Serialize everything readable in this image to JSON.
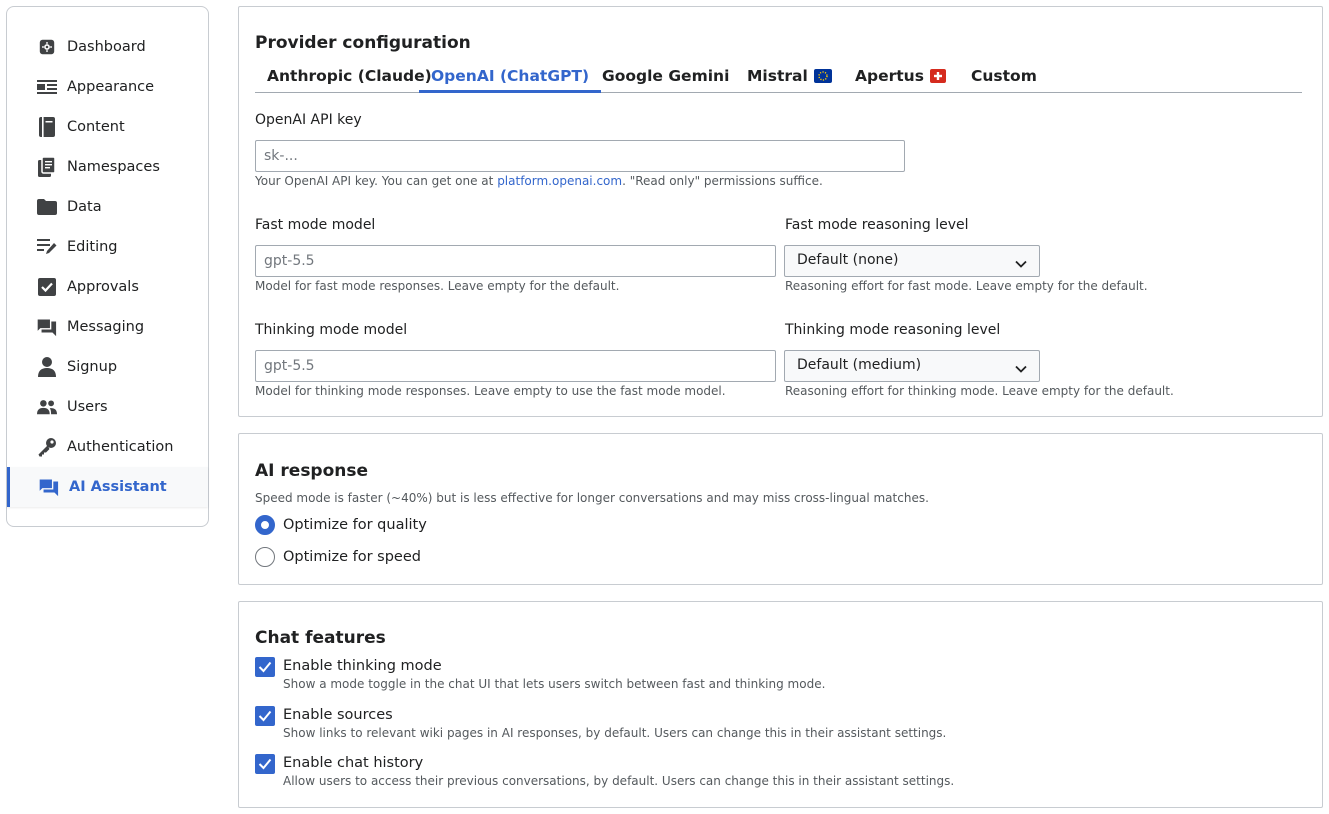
{
  "sidebar": {
    "items": [
      {
        "label": "Dashboard",
        "icon": "dashboard-icon",
        "active": false
      },
      {
        "label": "Appearance",
        "icon": "appearance-icon",
        "active": false
      },
      {
        "label": "Content",
        "icon": "content-icon",
        "active": false
      },
      {
        "label": "Namespaces",
        "icon": "namespaces-icon",
        "active": false
      },
      {
        "label": "Data",
        "icon": "folder-icon",
        "active": false
      },
      {
        "label": "Editing",
        "icon": "edit-icon",
        "active": false
      },
      {
        "label": "Approvals",
        "icon": "approvals-icon",
        "active": false
      },
      {
        "label": "Messaging",
        "icon": "messaging-icon",
        "active": false
      },
      {
        "label": "Signup",
        "icon": "user-icon",
        "active": false
      },
      {
        "label": "Users",
        "icon": "users-icon",
        "active": false
      },
      {
        "label": "Authentication",
        "icon": "key-icon",
        "active": false
      },
      {
        "label": "AI Assistant",
        "icon": "chat-icon",
        "active": true
      }
    ]
  },
  "provider": {
    "title": "Provider configuration",
    "tabs": [
      {
        "label": "Anthropic (Claude)",
        "active": false,
        "flag": ""
      },
      {
        "label": "OpenAI (ChatGPT)",
        "active": true,
        "flag": ""
      },
      {
        "label": "Google Gemini",
        "active": false,
        "flag": ""
      },
      {
        "label": "Mistral",
        "active": false,
        "flag": "eu-flag-icon"
      },
      {
        "label": "Apertus",
        "active": false,
        "flag": "swiss-flag-icon"
      },
      {
        "label": "Custom",
        "active": false,
        "flag": ""
      }
    ],
    "api_key": {
      "label": "OpenAI API key",
      "value": "",
      "placeholder": "sk-...",
      "help_before": "Your OpenAI API key. You can get one at ",
      "help_link": "platform.openai.com",
      "help_after": ". \"Read only\" permissions suffice."
    },
    "fast_model": {
      "label": "Fast mode model",
      "value": "",
      "placeholder": "gpt-5.5",
      "help": "Model for fast mode responses. Leave empty for the default."
    },
    "fast_reasoning": {
      "label": "Fast mode reasoning level",
      "selected": "Default (none)",
      "help": "Reasoning effort for fast mode. Leave empty for the default."
    },
    "thinking_model": {
      "label": "Thinking mode model",
      "value": "",
      "placeholder": "gpt-5.5",
      "help": "Model for thinking mode responses. Leave empty to use the fast mode model."
    },
    "thinking_reasoning": {
      "label": "Thinking mode reasoning level",
      "selected": "Default (medium)",
      "help": "Reasoning effort for thinking mode. Leave empty for the default."
    }
  },
  "ai_response": {
    "title": "AI response",
    "description": "Speed mode is faster (~40%) but is less effective for longer conversations and may miss cross-lingual matches.",
    "options": [
      {
        "label": "Optimize for quality",
        "checked": true
      },
      {
        "label": "Optimize for speed",
        "checked": false
      }
    ]
  },
  "chat_features": {
    "title": "Chat features",
    "items": [
      {
        "label": "Enable thinking mode",
        "help": "Show a mode toggle in the chat UI that lets users switch between fast and thinking mode.",
        "checked": true
      },
      {
        "label": "Enable sources",
        "help": "Show links to relevant wiki pages in AI responses, by default. Users can change this in their assistant settings.",
        "checked": true
      },
      {
        "label": "Enable chat history",
        "help": "Allow users to access their previous conversations, by default. Users can change this in their assistant settings.",
        "checked": true
      }
    ]
  },
  "colors": {
    "accent": "#3366cc",
    "text": "#202122",
    "muted": "#54595d",
    "border": "#c8ccd1",
    "icon": "#404244"
  }
}
